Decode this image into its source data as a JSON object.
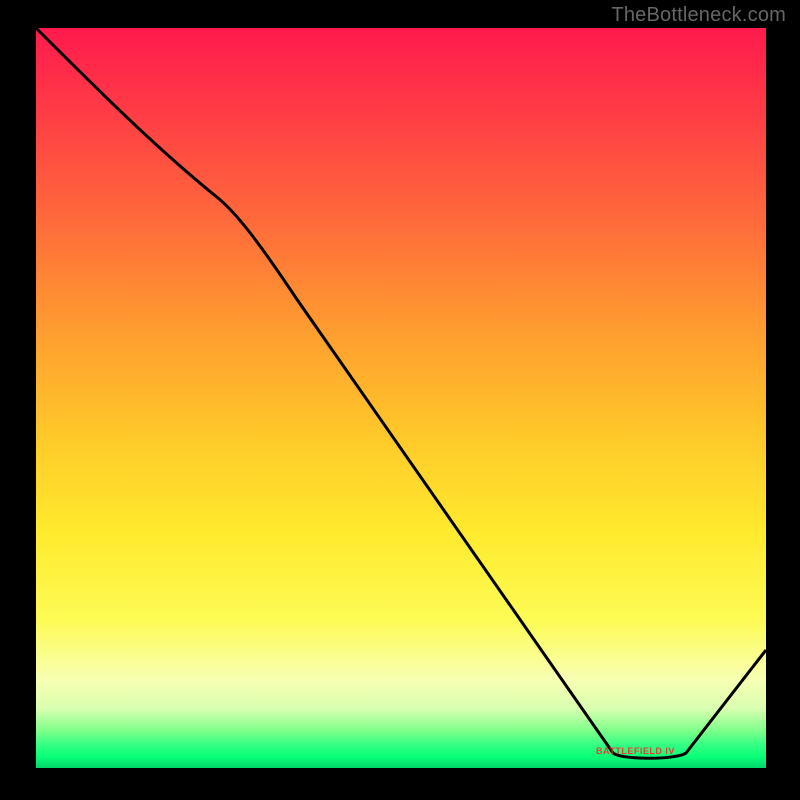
{
  "watermark": "TheBottleneck.com",
  "bottom_label": "BATTLEFIELD IV",
  "chart_data": {
    "type": "line",
    "title": "",
    "xlabel": "",
    "ylabel": "",
    "xlim": [
      0,
      100
    ],
    "ylim": [
      0,
      100
    ],
    "x": [
      0,
      25,
      79,
      89,
      100
    ],
    "values": [
      100,
      77,
      2,
      2,
      16
    ],
    "gradient_stops": [
      {
        "pct": 0,
        "color": "#ff1a4d"
      },
      {
        "pct": 12,
        "color": "#ff3e45"
      },
      {
        "pct": 26,
        "color": "#ff6a3b"
      },
      {
        "pct": 40,
        "color": "#ff9a30"
      },
      {
        "pct": 55,
        "color": "#ffc82a"
      },
      {
        "pct": 68,
        "color": "#ffea2d"
      },
      {
        "pct": 80,
        "color": "#fdfb55"
      },
      {
        "pct": 88,
        "color": "#f8ffb2"
      },
      {
        "pct": 92,
        "color": "#d9ffb0"
      },
      {
        "pct": 95,
        "color": "#7dff8a"
      },
      {
        "pct": 97,
        "color": "#2fff83"
      },
      {
        "pct": 98.5,
        "color": "#0aff78"
      },
      {
        "pct": 100,
        "color": "#00d66a"
      }
    ]
  }
}
